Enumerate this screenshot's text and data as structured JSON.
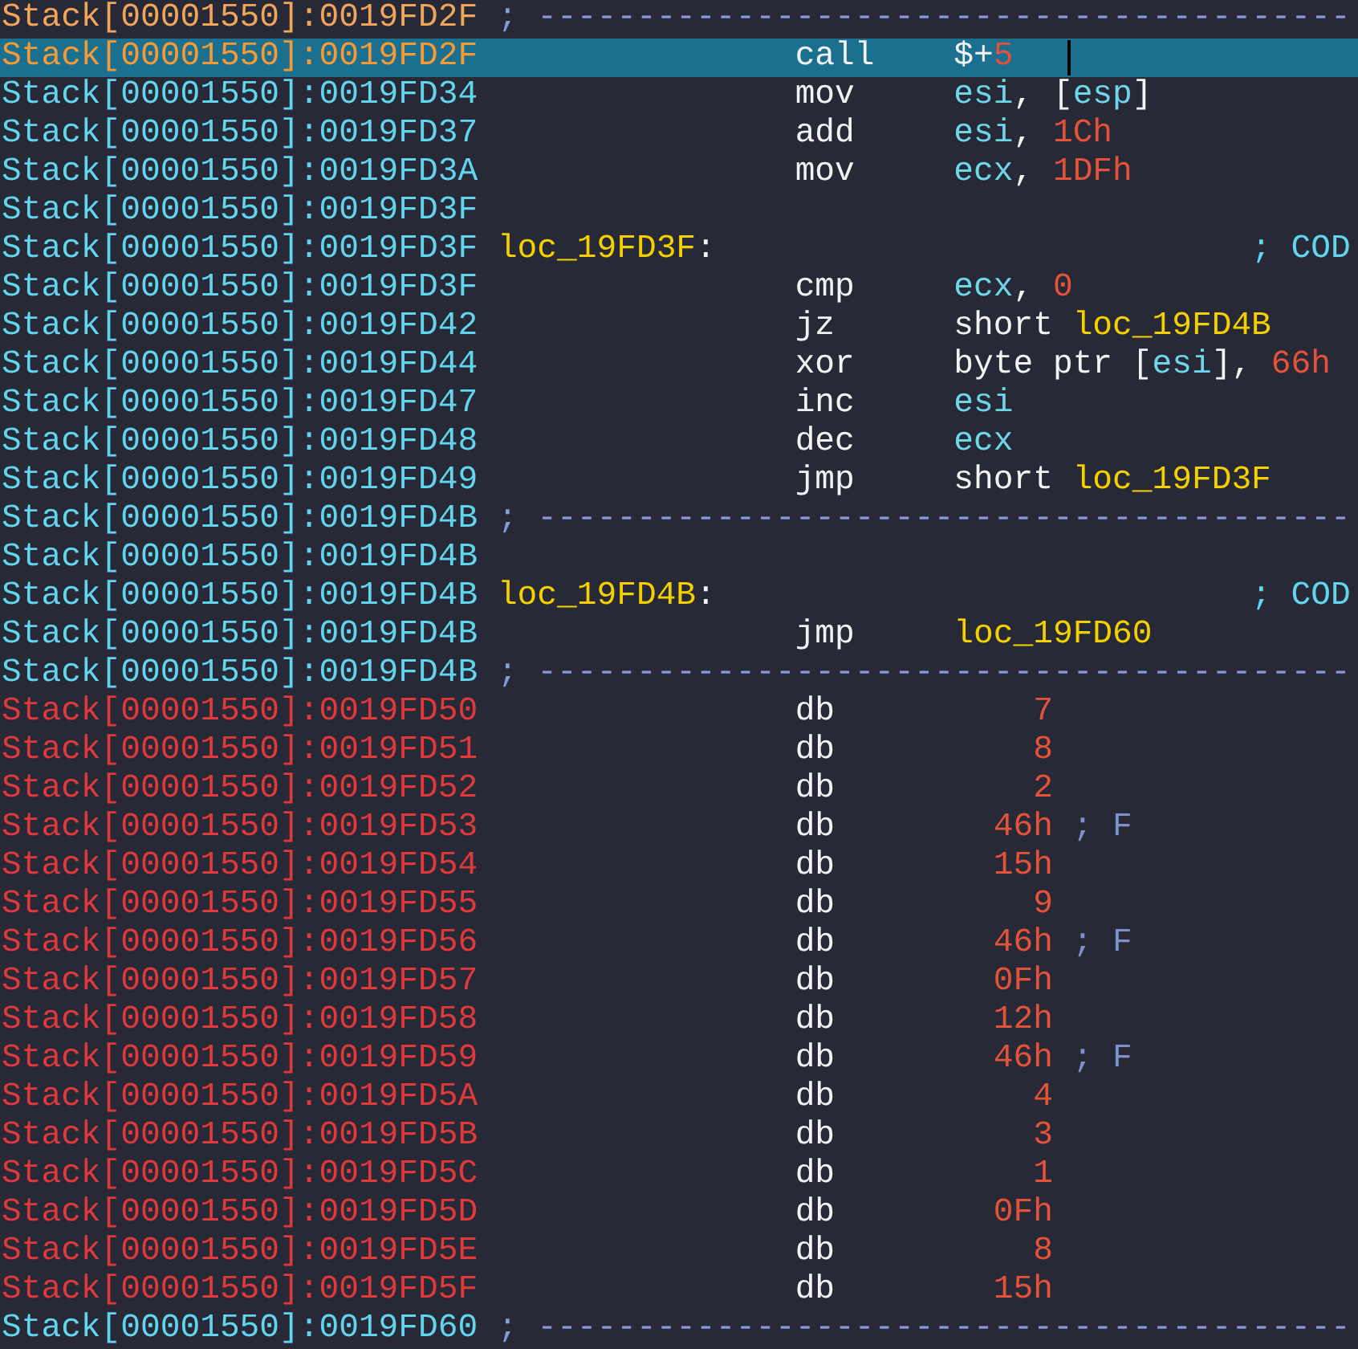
{
  "lines": [
    {
      "address": {
        "text": "Stack[00001550]:0019FD2F",
        "kind": "current"
      },
      "selected": false,
      "kind": "separator",
      "comment": "; -----------------------------------------"
    },
    {
      "address": {
        "text": "Stack[00001550]:0019FD2F",
        "kind": "current"
      },
      "selected": true,
      "kind": "insn",
      "mnemonic": "call",
      "operands": [
        {
          "text": "$+",
          "kind": "plain"
        },
        {
          "text": "5",
          "kind": "num"
        }
      ]
    },
    {
      "address": {
        "text": "Stack[00001550]:0019FD34",
        "kind": "code"
      },
      "selected": false,
      "kind": "insn",
      "mnemonic": "mov",
      "operands": [
        {
          "text": "esi",
          "kind": "reg"
        },
        {
          "text": ", [",
          "kind": "plain"
        },
        {
          "text": "esp",
          "kind": "reg"
        },
        {
          "text": "]",
          "kind": "plain"
        }
      ]
    },
    {
      "address": {
        "text": "Stack[00001550]:0019FD37",
        "kind": "code"
      },
      "selected": false,
      "kind": "insn",
      "mnemonic": "add",
      "operands": [
        {
          "text": "esi",
          "kind": "reg"
        },
        {
          "text": ", ",
          "kind": "plain"
        },
        {
          "text": "1Ch",
          "kind": "num"
        }
      ]
    },
    {
      "address": {
        "text": "Stack[00001550]:0019FD3A",
        "kind": "code"
      },
      "selected": false,
      "kind": "insn",
      "mnemonic": "mov",
      "operands": [
        {
          "text": "ecx",
          "kind": "reg"
        },
        {
          "text": ", ",
          "kind": "plain"
        },
        {
          "text": "1DFh",
          "kind": "num"
        }
      ]
    },
    {
      "address": {
        "text": "Stack[00001550]:0019FD3F",
        "kind": "code"
      },
      "selected": false,
      "kind": "blank"
    },
    {
      "address": {
        "text": "Stack[00001550]:0019FD3F",
        "kind": "code"
      },
      "selected": false,
      "kind": "label",
      "tokens": [
        {
          "text": "loc_19FD3F",
          "kind": "label"
        },
        {
          "text": ":",
          "kind": "plain"
        }
      ],
      "comment": "; COD"
    },
    {
      "address": {
        "text": "Stack[00001550]:0019FD3F",
        "kind": "code"
      },
      "selected": false,
      "kind": "insn",
      "mnemonic": "cmp",
      "operands": [
        {
          "text": "ecx",
          "kind": "reg"
        },
        {
          "text": ", ",
          "kind": "plain"
        },
        {
          "text": "0",
          "kind": "num"
        }
      ]
    },
    {
      "address": {
        "text": "Stack[00001550]:0019FD42",
        "kind": "code"
      },
      "selected": false,
      "kind": "insn",
      "mnemonic": "jz",
      "operands": [
        {
          "text": "short ",
          "kind": "plain"
        },
        {
          "text": "loc_19FD4B",
          "kind": "label"
        }
      ]
    },
    {
      "address": {
        "text": "Stack[00001550]:0019FD44",
        "kind": "code"
      },
      "selected": false,
      "kind": "insn",
      "mnemonic": "xor",
      "operands": [
        {
          "text": "byte ptr [",
          "kind": "plain"
        },
        {
          "text": "esi",
          "kind": "reg"
        },
        {
          "text": "], ",
          "kind": "plain"
        },
        {
          "text": "66h",
          "kind": "num"
        }
      ]
    },
    {
      "address": {
        "text": "Stack[00001550]:0019FD47",
        "kind": "code"
      },
      "selected": false,
      "kind": "insn",
      "mnemonic": "inc",
      "operands": [
        {
          "text": "esi",
          "kind": "reg"
        }
      ]
    },
    {
      "address": {
        "text": "Stack[00001550]:0019FD48",
        "kind": "code"
      },
      "selected": false,
      "kind": "insn",
      "mnemonic": "dec",
      "operands": [
        {
          "text": "ecx",
          "kind": "reg"
        }
      ]
    },
    {
      "address": {
        "text": "Stack[00001550]:0019FD49",
        "kind": "code"
      },
      "selected": false,
      "kind": "insn",
      "mnemonic": "jmp",
      "operands": [
        {
          "text": "short ",
          "kind": "plain"
        },
        {
          "text": "loc_19FD3F",
          "kind": "label"
        }
      ]
    },
    {
      "address": {
        "text": "Stack[00001550]:0019FD4B",
        "kind": "code"
      },
      "selected": false,
      "kind": "separator",
      "comment": "; -----------------------------------------"
    },
    {
      "address": {
        "text": "Stack[00001550]:0019FD4B",
        "kind": "code"
      },
      "selected": false,
      "kind": "blank"
    },
    {
      "address": {
        "text": "Stack[00001550]:0019FD4B",
        "kind": "code"
      },
      "selected": false,
      "kind": "label",
      "tokens": [
        {
          "text": "loc_19FD4B",
          "kind": "label"
        },
        {
          "text": ":",
          "kind": "plain"
        }
      ],
      "comment": "; COD"
    },
    {
      "address": {
        "text": "Stack[00001550]:0019FD4B",
        "kind": "code"
      },
      "selected": false,
      "kind": "insn",
      "mnemonic": "jmp",
      "operands": [
        {
          "text": "loc_19FD60",
          "kind": "label"
        }
      ]
    },
    {
      "address": {
        "text": "Stack[00001550]:0019FD4B",
        "kind": "code"
      },
      "selected": false,
      "kind": "separator",
      "comment": "; -----------------------------------------"
    },
    {
      "address": {
        "text": "Stack[00001550]:0019FD50",
        "kind": "data"
      },
      "selected": false,
      "kind": "data",
      "mnemonic": "db",
      "value": "7"
    },
    {
      "address": {
        "text": "Stack[00001550]:0019FD51",
        "kind": "data"
      },
      "selected": false,
      "kind": "data",
      "mnemonic": "db",
      "value": "8"
    },
    {
      "address": {
        "text": "Stack[00001550]:0019FD52",
        "kind": "data"
      },
      "selected": false,
      "kind": "data",
      "mnemonic": "db",
      "value": "2"
    },
    {
      "address": {
        "text": "Stack[00001550]:0019FD53",
        "kind": "data"
      },
      "selected": false,
      "kind": "data",
      "mnemonic": "db",
      "value": "46h",
      "comment": "; F"
    },
    {
      "address": {
        "text": "Stack[00001550]:0019FD54",
        "kind": "data"
      },
      "selected": false,
      "kind": "data",
      "mnemonic": "db",
      "value": "15h"
    },
    {
      "address": {
        "text": "Stack[00001550]:0019FD55",
        "kind": "data"
      },
      "selected": false,
      "kind": "data",
      "mnemonic": "db",
      "value": "9"
    },
    {
      "address": {
        "text": "Stack[00001550]:0019FD56",
        "kind": "data"
      },
      "selected": false,
      "kind": "data",
      "mnemonic": "db",
      "value": "46h",
      "comment": "; F"
    },
    {
      "address": {
        "text": "Stack[00001550]:0019FD57",
        "kind": "data"
      },
      "selected": false,
      "kind": "data",
      "mnemonic": "db",
      "value": "0Fh"
    },
    {
      "address": {
        "text": "Stack[00001550]:0019FD58",
        "kind": "data"
      },
      "selected": false,
      "kind": "data",
      "mnemonic": "db",
      "value": "12h"
    },
    {
      "address": {
        "text": "Stack[00001550]:0019FD59",
        "kind": "data"
      },
      "selected": false,
      "kind": "data",
      "mnemonic": "db",
      "value": "46h",
      "comment": "; F"
    },
    {
      "address": {
        "text": "Stack[00001550]:0019FD5A",
        "kind": "data"
      },
      "selected": false,
      "kind": "data",
      "mnemonic": "db",
      "value": "4"
    },
    {
      "address": {
        "text": "Stack[00001550]:0019FD5B",
        "kind": "data"
      },
      "selected": false,
      "kind": "data",
      "mnemonic": "db",
      "value": "3"
    },
    {
      "address": {
        "text": "Stack[00001550]:0019FD5C",
        "kind": "data"
      },
      "selected": false,
      "kind": "data",
      "mnemonic": "db",
      "value": "1"
    },
    {
      "address": {
        "text": "Stack[00001550]:0019FD5D",
        "kind": "data"
      },
      "selected": false,
      "kind": "data",
      "mnemonic": "db",
      "value": "0Fh"
    },
    {
      "address": {
        "text": "Stack[00001550]:0019FD5E",
        "kind": "data"
      },
      "selected": false,
      "kind": "data",
      "mnemonic": "db",
      "value": "8"
    },
    {
      "address": {
        "text": "Stack[00001550]:0019FD5F",
        "kind": "data"
      },
      "selected": false,
      "kind": "data",
      "mnemonic": "db",
      "value": "15h"
    },
    {
      "address": {
        "text": "Stack[00001550]:0019FD60",
        "kind": "code"
      },
      "selected": false,
      "kind": "separator",
      "comment": "; -----------------------------------------"
    }
  ]
}
